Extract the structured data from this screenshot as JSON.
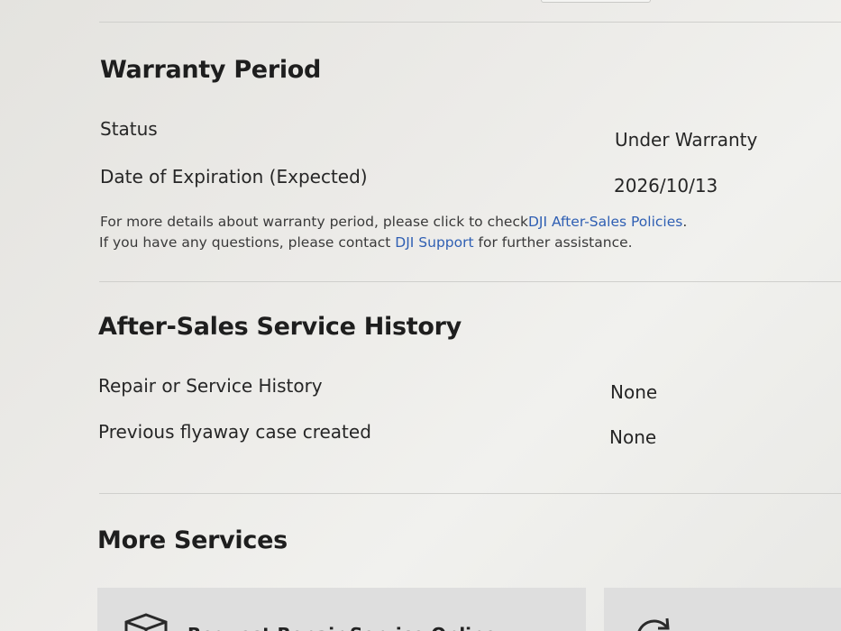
{
  "warranty": {
    "title": "Warranty Period",
    "status_label": "Status",
    "status_value": "Under Warranty",
    "expiration_label": "Date of Expiration (Expected)",
    "expiration_value": "2026/10/13",
    "note_line1_prefix": "For more details about warranty period, please click to check",
    "policies_link": "DJI After-Sales Policies",
    "note_line1_suffix": ".",
    "note_line2_prefix": "If you have any questions, please contact ",
    "support_link": "DJI Support",
    "note_line2_suffix": " for further assistance."
  },
  "history": {
    "title": "After-Sales Service History",
    "repair_label": "Repair or Service History",
    "repair_value": "None",
    "flyaway_label": "Previous flyaway case created",
    "flyaway_value": "None"
  },
  "more_services": {
    "title": "More Services",
    "cards": [
      {
        "label": "Request Repair Service Online",
        "icon": "package-icon"
      },
      {
        "label": "",
        "icon": "refresh-icon"
      }
    ]
  }
}
